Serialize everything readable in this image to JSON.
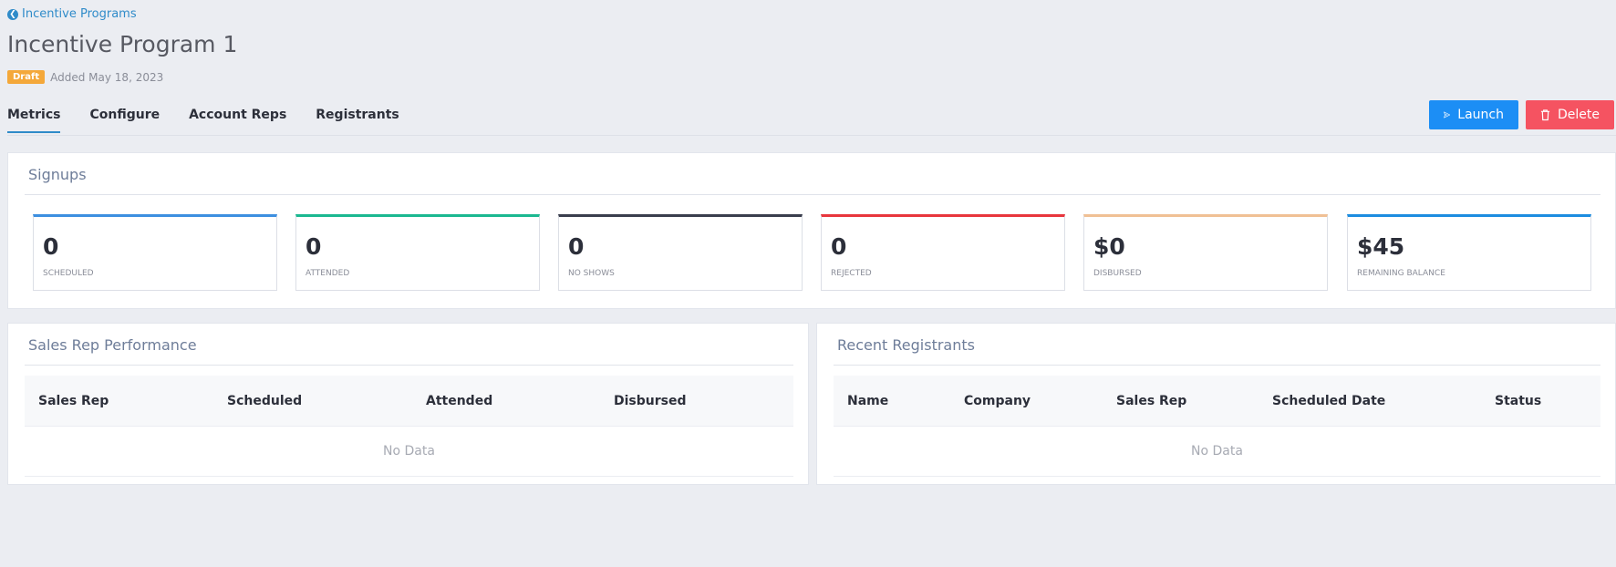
{
  "back_link": {
    "icon": "arrow-circle-left-icon",
    "label": "Incentive Programs"
  },
  "page_title": "Incentive Program 1",
  "status_badge": "Draft",
  "added_text": "Added May 18, 2023",
  "tabs": [
    {
      "label": "Metrics",
      "active": true
    },
    {
      "label": "Configure",
      "active": false
    },
    {
      "label": "Account Reps",
      "active": false
    },
    {
      "label": "Registrants",
      "active": false
    }
  ],
  "actions": {
    "launch": {
      "label": "Launch",
      "icon": "send-icon",
      "color": "#1c8ef5"
    },
    "delete": {
      "label": "Delete",
      "icon": "trash-icon",
      "color": "#f55361"
    }
  },
  "signups": {
    "title": "Signups",
    "stats": [
      {
        "value": "0",
        "label": "SCHEDULED",
        "color": "#3d8fe0"
      },
      {
        "value": "0",
        "label": "ATTENDED",
        "color": "#1bb890"
      },
      {
        "value": "0",
        "label": "NO SHOWS",
        "color": "#3a3e4d"
      },
      {
        "value": "0",
        "label": "REJECTED",
        "color": "#e8363d"
      },
      {
        "value": "$0",
        "label": "DISBURSED",
        "color": "#f0c094"
      },
      {
        "value": "$45",
        "label": "REMAINING BALANCE",
        "color": "#1c8ce0"
      }
    ]
  },
  "sales_rep_performance": {
    "title": "Sales Rep Performance",
    "columns": [
      "Sales Rep",
      "Scheduled",
      "Attended",
      "Disbursed"
    ],
    "empty_text": "No Data"
  },
  "recent_registrants": {
    "title": "Recent Registrants",
    "columns": [
      "Name",
      "Company",
      "Sales Rep",
      "Scheduled Date",
      "Status"
    ],
    "empty_text": "No Data"
  }
}
